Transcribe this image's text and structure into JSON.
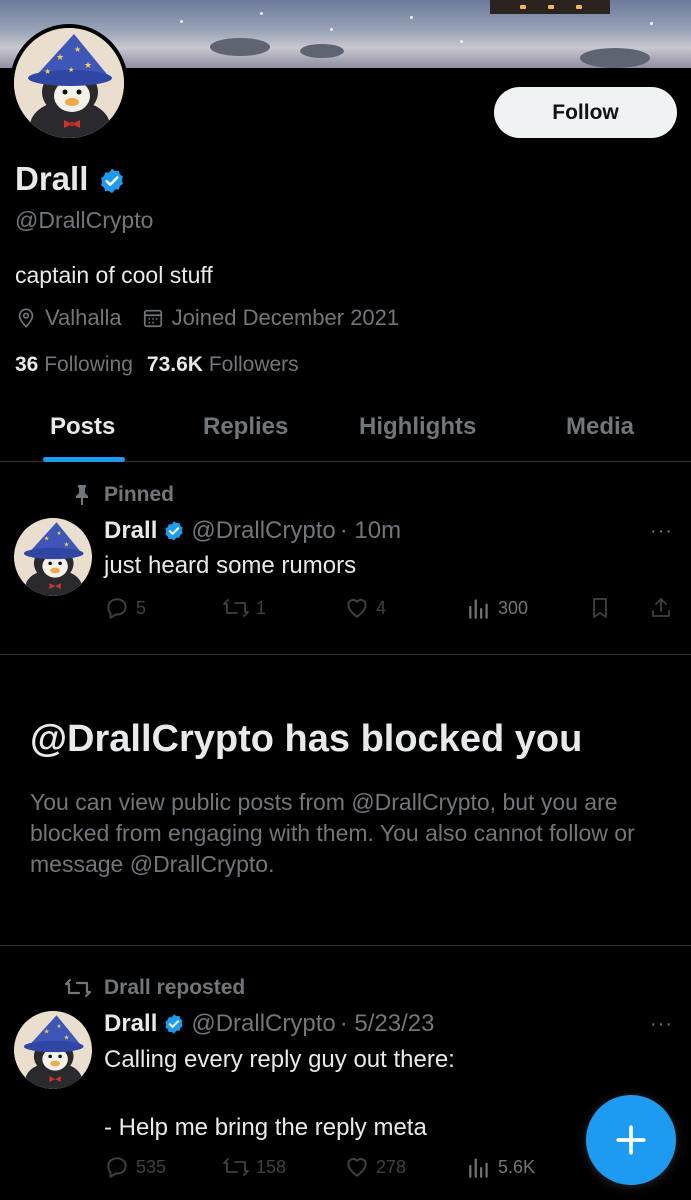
{
  "profile": {
    "name": "Drall",
    "handle": "@DrallCrypto",
    "bio": "captain of cool stuff",
    "location": "Valhalla",
    "joined": "Joined December 2021",
    "following_count": "36",
    "following_label": "Following",
    "followers_count": "73.6K",
    "followers_label": "Followers",
    "follow_label": "Follow"
  },
  "tabs": [
    {
      "label": "Posts",
      "active": true
    },
    {
      "label": "Replies",
      "active": false
    },
    {
      "label": "Highlights",
      "active": false
    },
    {
      "label": "Media",
      "active": false
    }
  ],
  "pinned_post": {
    "pinned_label": "Pinned",
    "author": "Drall",
    "handle": "@DrallCrypto",
    "time": "· 10m",
    "text": "just heard some rumors",
    "replies": "5",
    "reposts": "1",
    "likes": "4",
    "views": "300",
    "more": "···"
  },
  "blocked": {
    "title": "@DrallCrypto has blocked you",
    "description": "You can view public posts from @DrallCrypto, but you are blocked from engaging with them. You also cannot follow or message @DrallCrypto."
  },
  "repost": {
    "repost_label": "Drall reposted",
    "author": "Drall",
    "handle": "@DrallCrypto",
    "time": "· 5/23/23",
    "text_line1": "Calling every reply guy out there:",
    "text_line2": "- Help me bring the reply meta",
    "replies": "535",
    "reposts": "158",
    "likes": "278",
    "views": "5.6K",
    "more": "···"
  },
  "colors": {
    "accent": "#1d9bf0",
    "background": "#000000",
    "text_primary": "#e7e9ea",
    "text_secondary": "#71767b"
  },
  "fab": {
    "icon": "plus-icon"
  }
}
